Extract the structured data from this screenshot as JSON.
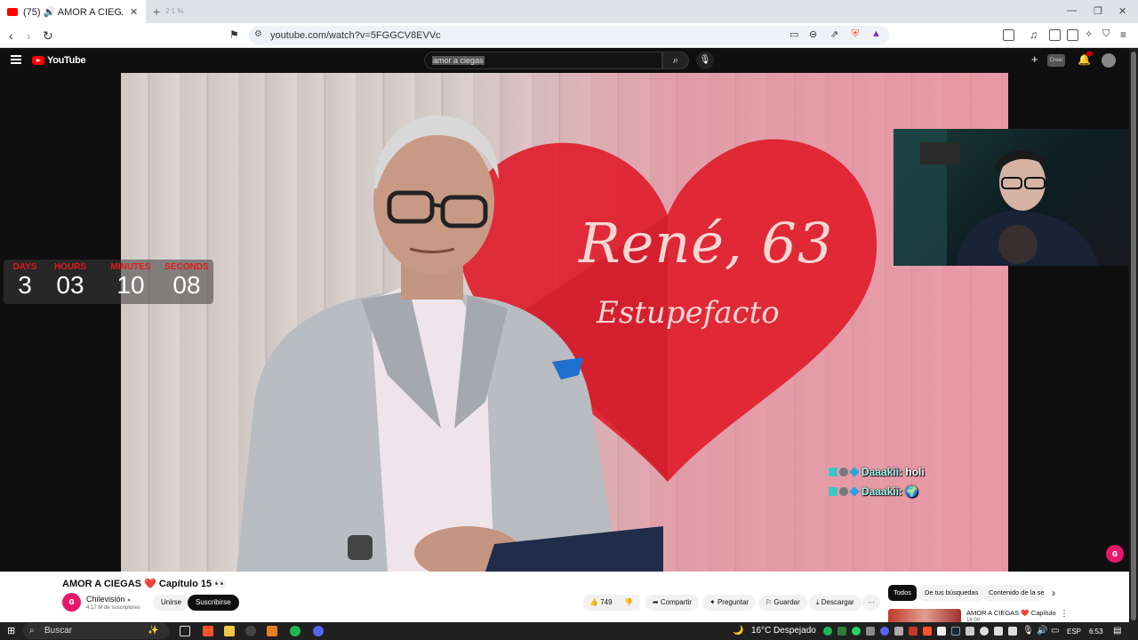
{
  "browser": {
    "tab_title": "(75) 🔊 AMOR A CIEGAS ❤️ Cap",
    "tab_extra": "2 1 %",
    "url": "youtube.com/watch?v=5FGGCV8EVVc"
  },
  "youtube": {
    "logo": "YouTube",
    "search_value": "amor a ciegas",
    "create_label": "Crear"
  },
  "countdown": {
    "items": [
      {
        "label": "DAYS",
        "value": "3"
      },
      {
        "label": "HOURS",
        "value": "03"
      },
      {
        "label": "MINUTES",
        "value": "10"
      },
      {
        "label": "SECONDS",
        "value": "08"
      }
    ]
  },
  "video_overlay": {
    "name_age": "René, 63",
    "caption": "Estupefacto"
  },
  "chat": [
    {
      "user": "Daaakii:",
      "text": "holi"
    },
    {
      "user": "Daaakii:",
      "text": "🌍"
    }
  ],
  "video_info": {
    "title": "AMOR A CIEGAS ❤️ Capítulo 15 👀",
    "channel": "Chilevisión",
    "channel_initial": "ɞ",
    "subscribers": "4.17 M de suscriptores",
    "join_label": "Unirse",
    "subscribe_label": "Suscribirse",
    "likes": "749",
    "share_label": "Compartir",
    "ask_label": "Preguntar",
    "save_label": "Guardar",
    "download_label": "Descargar",
    "more_label": "···"
  },
  "sidebar": {
    "filters": [
      "Todos",
      "De tus búsquedas",
      "Contenido de la se"
    ],
    "rec_title": "AMOR A CIEGAS ❤️ Capítulo",
    "rec_sub": "16 00"
  },
  "taskbar": {
    "search_label": "Buscar",
    "weather_temp": "16°C",
    "weather_desc": "Despejado",
    "language": "ESP",
    "time": "6:53"
  },
  "colors": {
    "youtube_red": "#ff0000",
    "countdown_label": "#e41a1a",
    "heart": "#e01e2e",
    "chilevision": "#e5186b"
  }
}
